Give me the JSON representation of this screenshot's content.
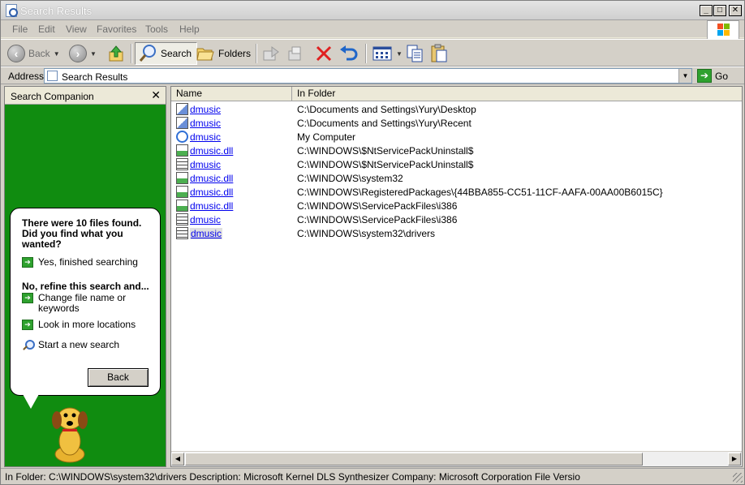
{
  "window": {
    "title": "Search Results",
    "controls": {
      "minimize": "_",
      "maximize": "□",
      "close": "✕"
    }
  },
  "menubar": {
    "items": [
      "File",
      "Edit",
      "View",
      "Favorites",
      "Tools",
      "Help"
    ]
  },
  "toolbar": {
    "back_label": "Back",
    "search_label": "Search",
    "folders_label": "Folders"
  },
  "addressbar": {
    "label": "Address",
    "value": "Search Results",
    "go_label": "Go"
  },
  "companion": {
    "title": "Search Companion",
    "close_glyph": "✕",
    "question": "There were 10 files found. Did you find what you wanted?",
    "yes_link": "Yes, finished searching",
    "refine_heading": "No, refine this search and...",
    "change_link": "Change file name or keywords",
    "more_locations_link": "Look in more locations",
    "new_search_link": "Start a new search",
    "back_button": "Back"
  },
  "results": {
    "columns": [
      "Name",
      "In Folder"
    ],
    "rows": [
      {
        "name": "dmusic",
        "folder": "C:\\Documents and Settings\\Yury\\Desktop",
        "icon": "shortcut-icon"
      },
      {
        "name": "dmusic",
        "folder": "C:\\Documents and Settings\\Yury\\Recent",
        "icon": "shortcut-icon"
      },
      {
        "name": "dmusic",
        "folder": "My Computer",
        "icon": "ie-icon"
      },
      {
        "name": "dmusic.dll",
        "folder": "C:\\WINDOWS\\$NtServicePackUninstall$",
        "icon": "dll-icon"
      },
      {
        "name": "dmusic",
        "folder": "C:\\WINDOWS\\$NtServicePackUninstall$",
        "icon": "sys-file-icon"
      },
      {
        "name": "dmusic.dll",
        "folder": "C:\\WINDOWS\\system32",
        "icon": "dll-icon"
      },
      {
        "name": "dmusic.dll",
        "folder": "C:\\WINDOWS\\RegisteredPackages\\{44BBA855-CC51-11CF-AAFA-00AA00B6015C}",
        "icon": "dll-icon"
      },
      {
        "name": "dmusic.dll",
        "folder": "C:\\WINDOWS\\ServicePackFiles\\i386",
        "icon": "dll-icon"
      },
      {
        "name": "dmusic",
        "folder": "C:\\WINDOWS\\ServicePackFiles\\i386",
        "icon": "sys-file-icon"
      },
      {
        "name": "dmusic",
        "folder": "C:\\WINDOWS\\system32\\drivers",
        "icon": "sys-file-icon"
      }
    ]
  },
  "statusbar": {
    "text": "In Folder: C:\\WINDOWS\\system32\\drivers Description: Microsoft Kernel DLS Synthesizer Company: Microsoft Corporation File Versio"
  }
}
